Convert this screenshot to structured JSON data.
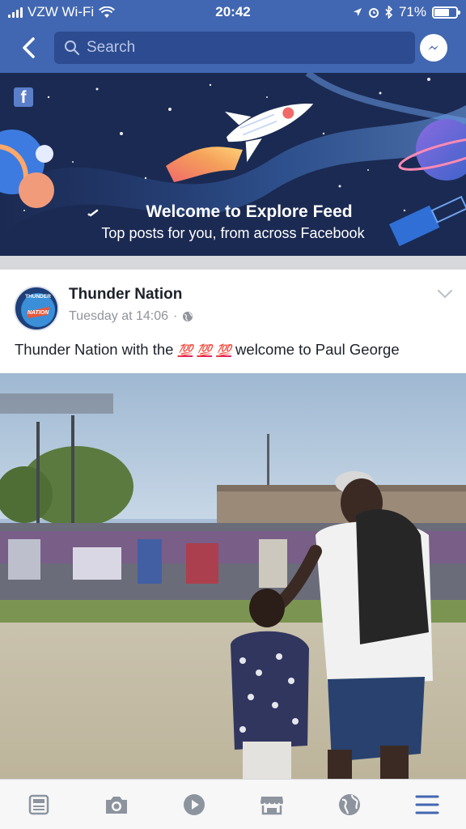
{
  "status_bar": {
    "carrier": "VZW Wi-Fi",
    "time": "20:42",
    "battery": "71%",
    "battery_level": 0.71
  },
  "nav": {
    "search_placeholder": "Search"
  },
  "banner": {
    "title": "Welcome to Explore Feed",
    "subtitle": "Top posts for you, from across Facebook"
  },
  "post": {
    "page_name": "Thunder Nation",
    "timestamp": "Tuesday at 14:06",
    "separator": "·",
    "text_before": "Thunder Nation with the",
    "emojis": [
      "💯",
      "💯",
      "💯"
    ],
    "text_after": "welcome to Paul George",
    "avatar_text_top": "THUNDER",
    "avatar_text_bottom": "NATION"
  },
  "tabs": [
    {
      "icon": "news-feed-icon"
    },
    {
      "icon": "camera-icon"
    },
    {
      "icon": "video-play-icon"
    },
    {
      "icon": "marketplace-icon"
    },
    {
      "icon": "globe-icon"
    },
    {
      "icon": "menu-icon",
      "active": true
    }
  ],
  "colors": {
    "brand": "#4267b2",
    "banner_bg": "#1b2a52",
    "active_tab": "#4267b2",
    "inactive_tab": "#8d949e"
  }
}
